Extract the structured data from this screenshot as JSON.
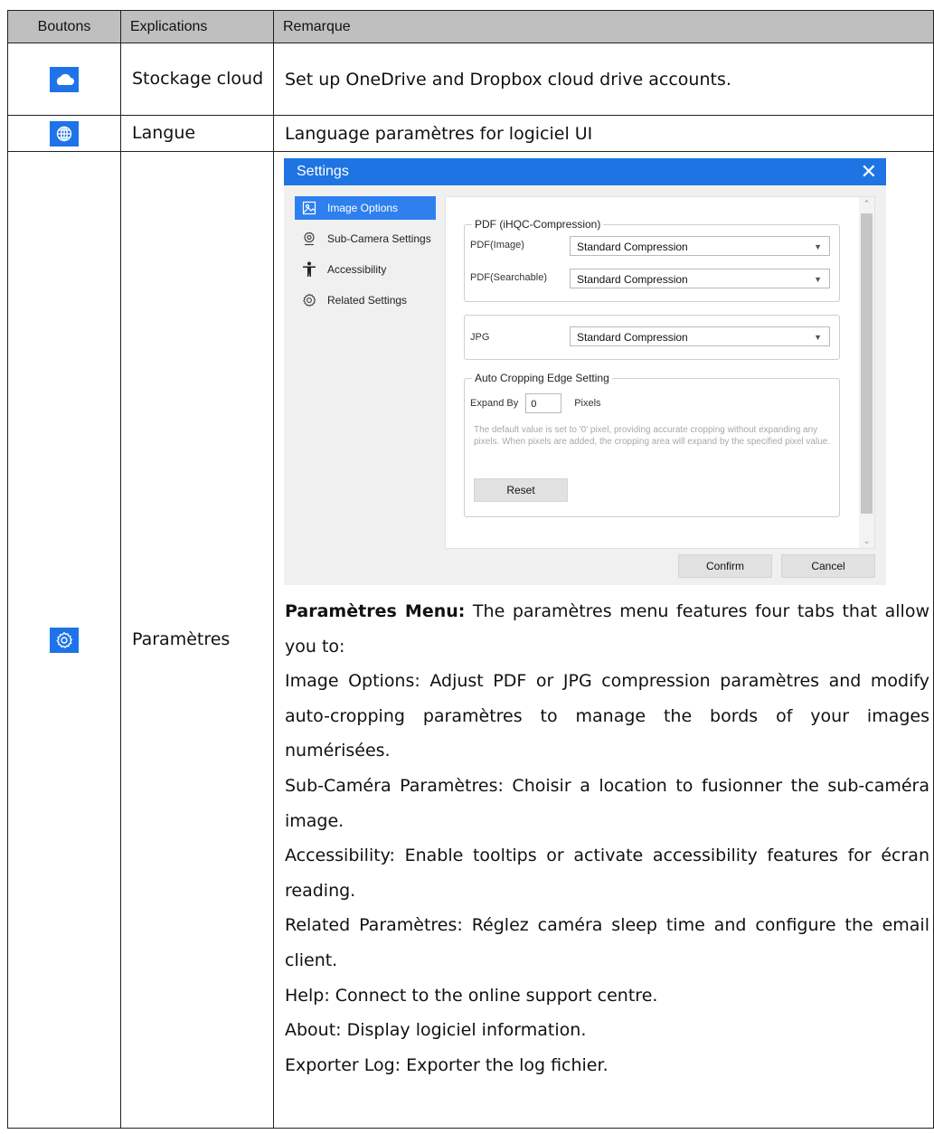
{
  "table": {
    "headers": [
      "Boutons",
      "Explications",
      "Remarque"
    ],
    "rows": [
      {
        "icon": "cloud-icon",
        "explication": "Stockage cloud",
        "remarque": "Set up OneDrive and Dropbox cloud drive accounts."
      },
      {
        "icon": "globe-icon",
        "explication": "Langue",
        "remarque": "Language paramètres for logiciel UI"
      },
      {
        "icon": "gear-icon",
        "explication": "Paramètres"
      }
    ]
  },
  "settings": {
    "title": "Settings",
    "tabs": [
      "Image Options",
      "Sub-Camera Settings",
      "Accessibility",
      "Related Settings"
    ],
    "pdf_group": {
      "legend": "PDF (iHQC-Compression)",
      "rows": [
        {
          "label": "PDF(Image)",
          "value": "Standard Compression"
        },
        {
          "label": "PDF(Searchable)",
          "value": "Standard Compression"
        }
      ]
    },
    "jpg": {
      "label": "JPG",
      "value": "Standard Compression"
    },
    "crop_group": {
      "legend": "Auto Cropping Edge Setting",
      "expand_label": "Expand By",
      "expand_value": "0",
      "unit": "Pixels",
      "help": "The default value is set to '0' pixel, providing accurate cropping without expanding any pixels. When pixels are added, the cropping area will expand by the specified pixel value.",
      "reset": "Reset"
    },
    "confirm": "Confirm",
    "cancel": "Cancel"
  },
  "description": {
    "heading": "Paramètres Menu:",
    "intro": " The paramètres menu features four tabs that allow you to:",
    "lines": [
      "Image Options: Adjust PDF or JPG compression paramètres and modify auto-cropping paramètres to manage the bords of your images numérisées.",
      "Sub-Caméra Paramètres: Choisir a location to fusionner the sub-caméra image.",
      "Accessibility: Enable tooltips or activate accessibility features for écran reading.",
      "Related Paramètres: Réglez caméra sleep time and configure the email client.",
      "Help: Connect to the online support centre.",
      "About: Display logiciel information.",
      "Exporter Log: Exporter the log fichier."
    ]
  }
}
